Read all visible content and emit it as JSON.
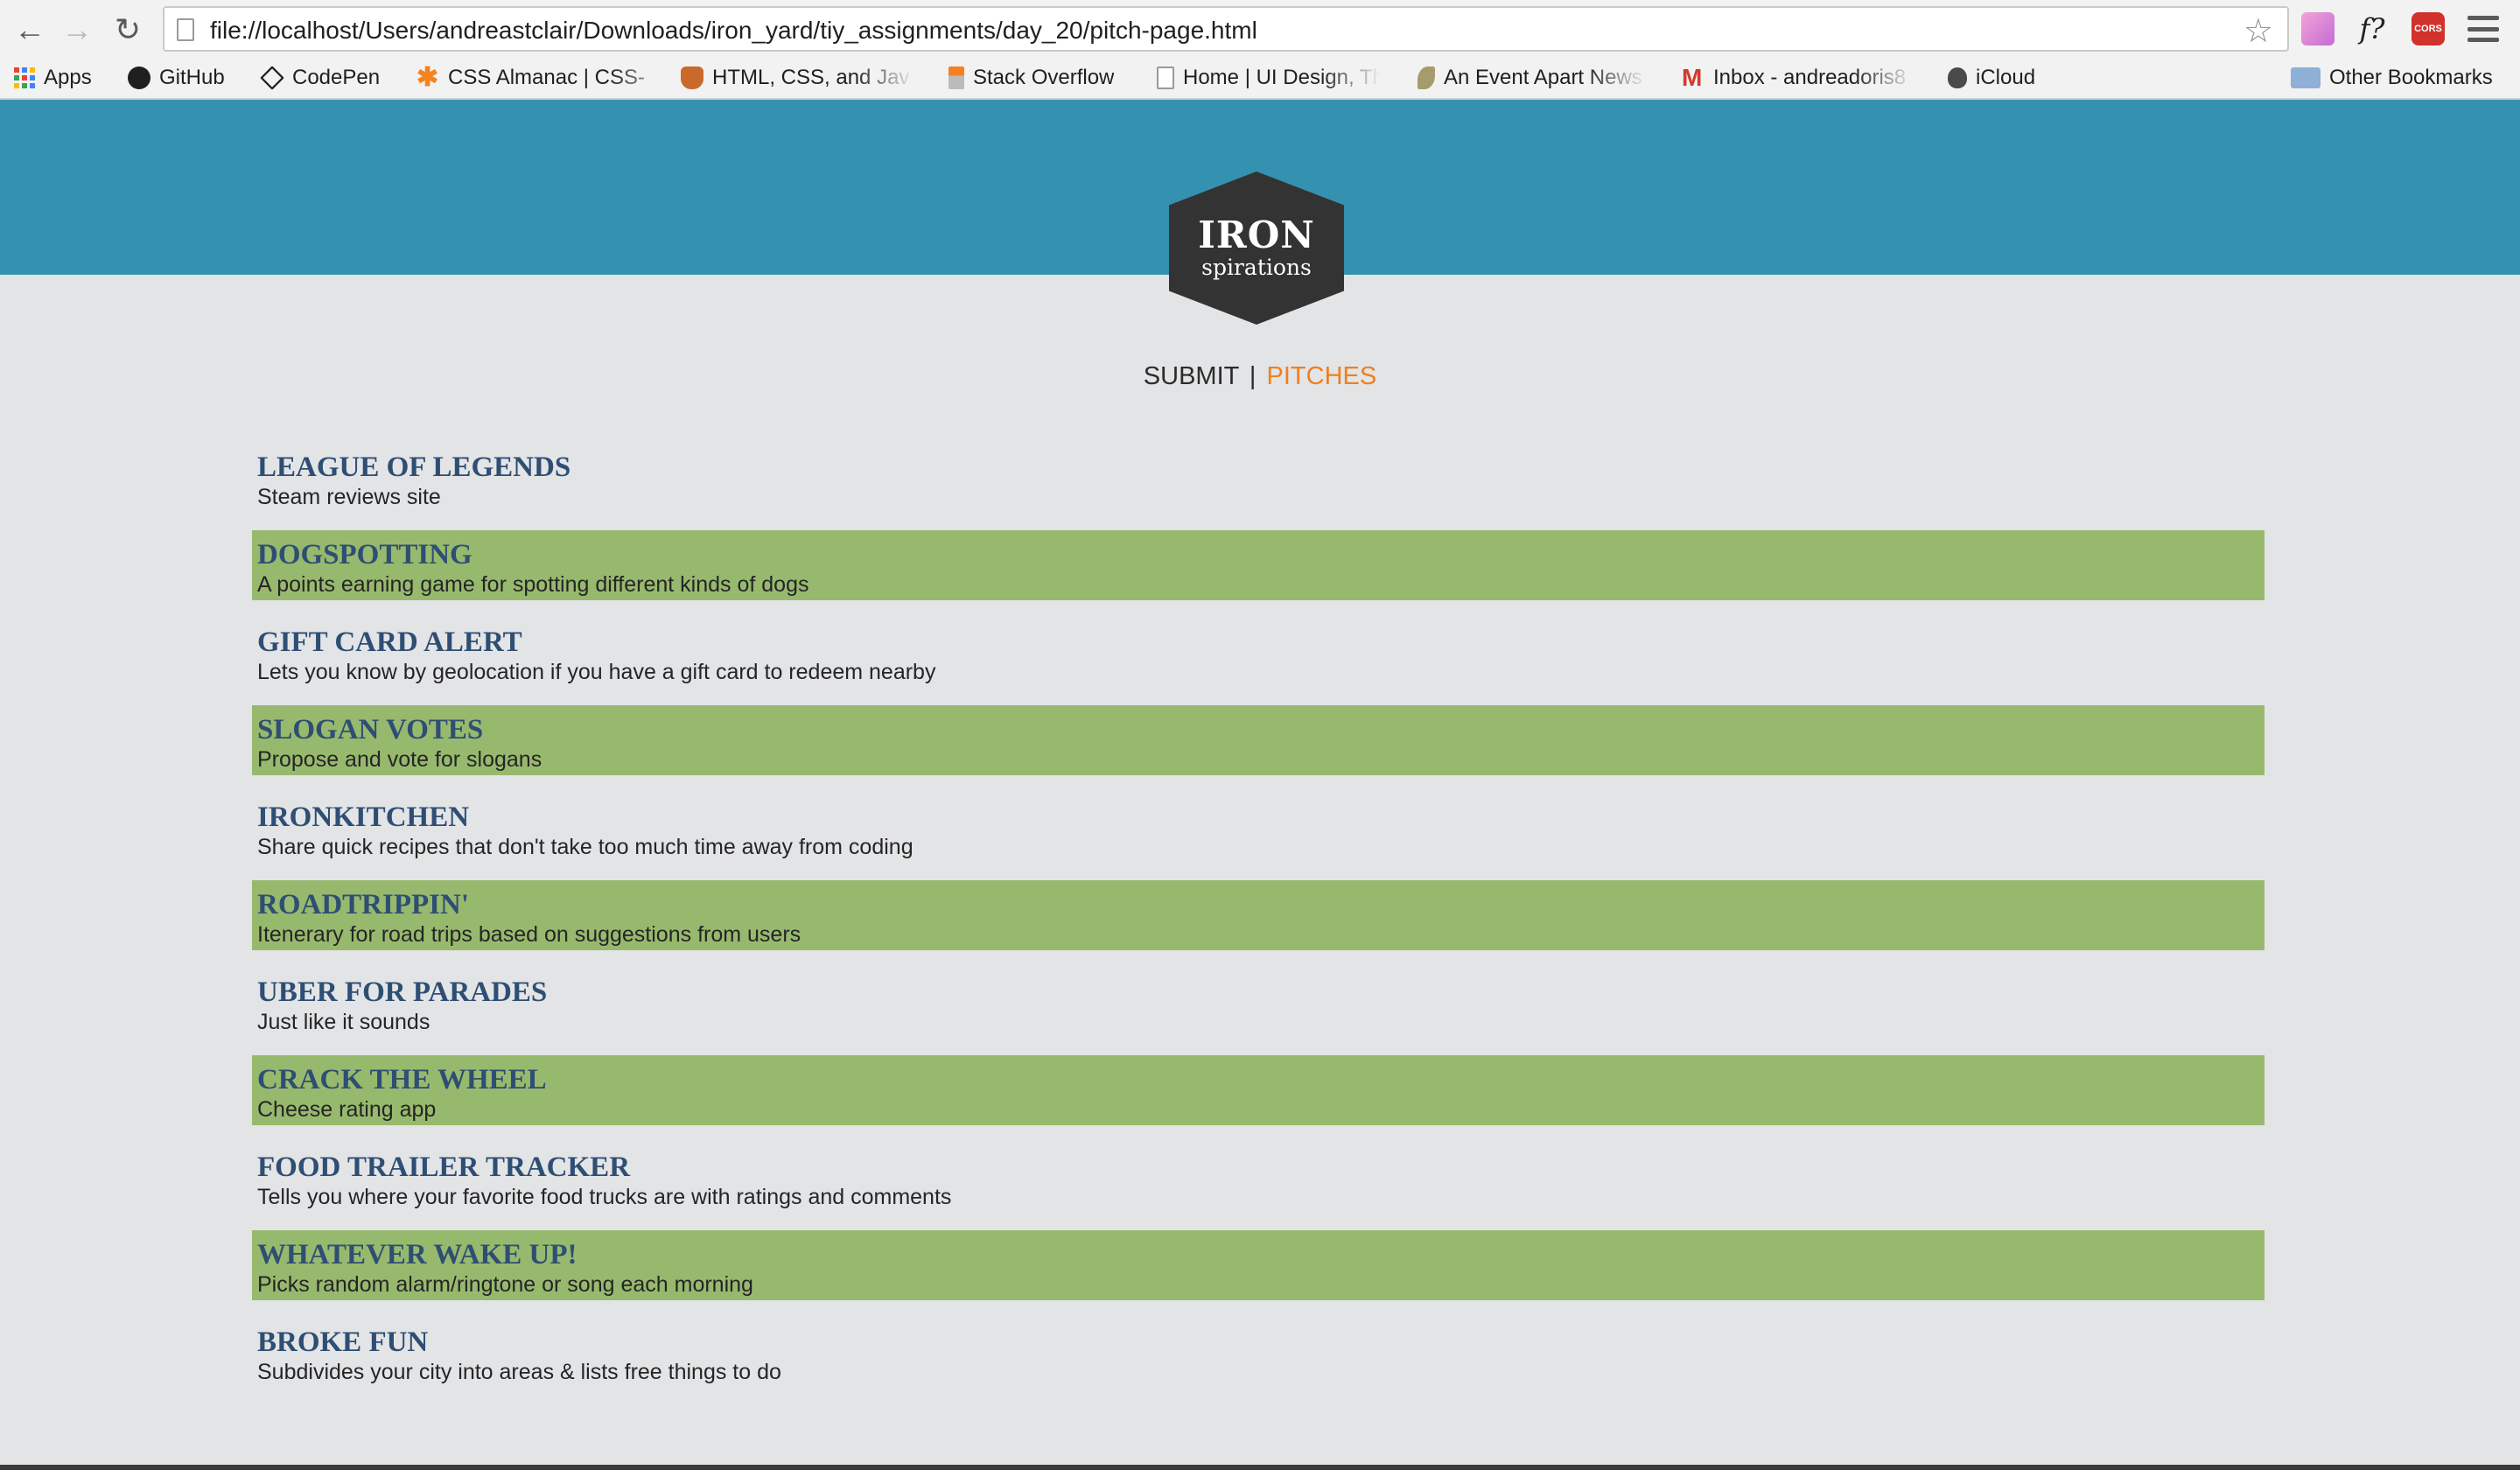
{
  "browser": {
    "url": "file://localhost/Users/andreastclair/Downloads/iron_yard/tiy_assignments/day_20/pitch-page.html",
    "back_icon": "←",
    "forward_icon": "→",
    "reload_icon": "↻",
    "star_icon": "☆",
    "extensions": {
      "fx_label": "f?",
      "cors_label": "CORS"
    },
    "bookmarks": [
      {
        "label": "Apps",
        "icon": "apps-icon"
      },
      {
        "label": "GitHub",
        "icon": "github-icon"
      },
      {
        "label": "CodePen",
        "icon": "codepen-icon"
      },
      {
        "label": "CSS Almanac | CSS-",
        "icon": "css-tricks-icon"
      },
      {
        "label": "HTML, CSS, and Jav",
        "icon": "fox-icon"
      },
      {
        "label": "Stack Overflow",
        "icon": "stackoverflow-icon"
      },
      {
        "label": "Home | UI Design, Th",
        "icon": "page-icon"
      },
      {
        "label": "An Event Apart News",
        "icon": "leaf-icon"
      },
      {
        "label": "Inbox - andreadoris8",
        "icon": "gmail-icon"
      },
      {
        "label": "iCloud",
        "icon": "apple-icon"
      }
    ],
    "other_bookmarks": "Other Bookmarks"
  },
  "site": {
    "logo": {
      "title": "IRON",
      "subtitle": "spirations"
    },
    "nav": {
      "submit": "SUBMIT",
      "separator": "|",
      "pitches": "PITCHES"
    },
    "colors": {
      "header": "#3591b0",
      "accent": "#f07f1e",
      "row_highlight": "#97b96d",
      "title": "#2e4e74"
    }
  },
  "pitches": [
    {
      "title": "LEAGUE OF LEGENDS",
      "description": "Steam reviews site"
    },
    {
      "title": "DOGSPOTTING",
      "description": "A points earning game for spotting different kinds of dogs"
    },
    {
      "title": "GIFT CARD ALERT",
      "description": "Lets you know by geolocation if you have a gift card to redeem nearby"
    },
    {
      "title": "SLOGAN VOTES",
      "description": "Propose and vote for slogans"
    },
    {
      "title": "IRONKITCHEN",
      "description": "Share quick recipes that don't take too much time away from coding"
    },
    {
      "title": "ROADTRIPPIN'",
      "description": "Itenerary for road trips based on suggestions from users"
    },
    {
      "title": "UBER FOR PARADES",
      "description": "Just like it sounds"
    },
    {
      "title": "CRACK THE WHEEL",
      "description": "Cheese rating app"
    },
    {
      "title": "FOOD TRAILER TRACKER",
      "description": "Tells you where your favorite food trucks are with ratings and comments"
    },
    {
      "title": "WHATEVER WAKE UP!",
      "description": "Picks random alarm/ringtone or song each morning"
    },
    {
      "title": "BROKE FUN",
      "description": "Subdivides your city into areas & lists free things to do"
    }
  ]
}
